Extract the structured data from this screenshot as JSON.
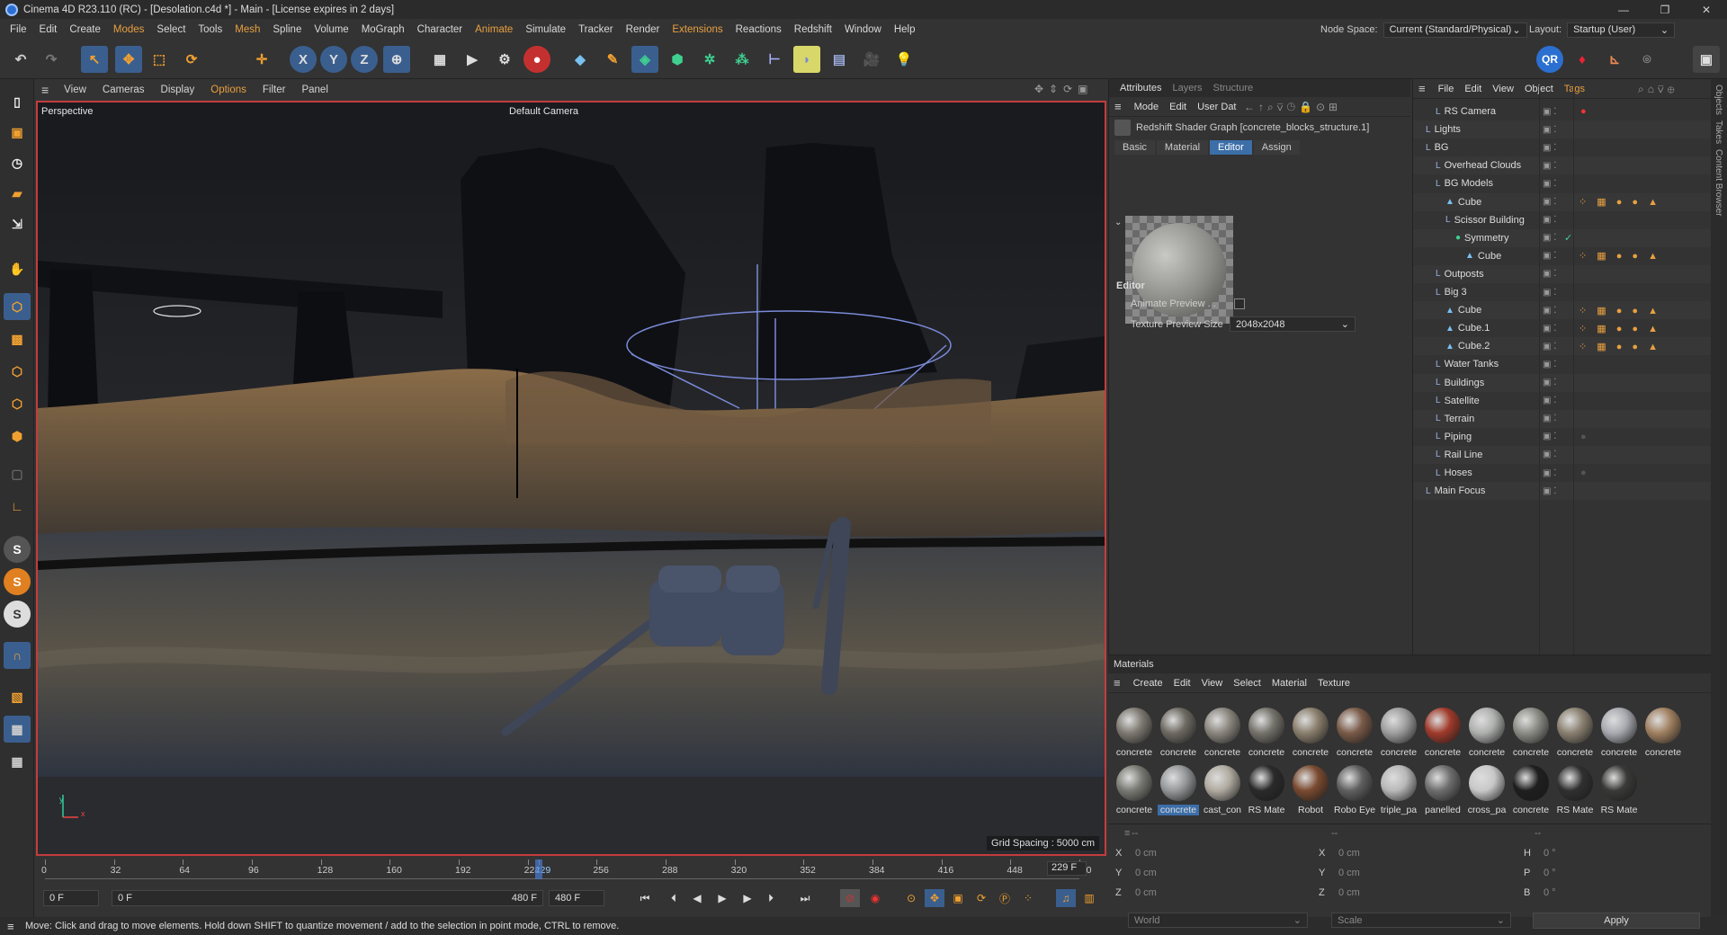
{
  "window": {
    "title": "Cinema 4D R23.110 (RC) - [Desolation.c4d *] - Main - [License expires in 2 days]"
  },
  "menu": [
    "File",
    "Edit",
    "Create",
    "Modes",
    "Select",
    "Tools",
    "Mesh",
    "Spline",
    "Volume",
    "MoGraph",
    "Character",
    "Animate",
    "Simulate",
    "Tracker",
    "Render",
    "Extensions",
    "Reactions",
    "Redshift",
    "Window",
    "Help"
  ],
  "node_space": {
    "label": "Node Space:",
    "value": "Current (Standard/Physical)"
  },
  "layout": {
    "label": "Layout:",
    "value": "Startup (User)"
  },
  "viewport_menu": [
    "View",
    "Cameras",
    "Display",
    "Options",
    "Filter",
    "Panel"
  ],
  "viewport": {
    "name": "Perspective",
    "camera": "Default Camera",
    "grid_spacing": "Grid Spacing : 5000 cm"
  },
  "timeline": {
    "ticks": [
      "0",
      "32",
      "64",
      "96",
      "128",
      "160",
      "192",
      "224",
      "229",
      "256",
      "288",
      "320",
      "352",
      "384",
      "416",
      "448",
      "480"
    ],
    "current_frame": "229 F",
    "start": "0 F",
    "range_start": "0 F",
    "range_end": "480 F",
    "end": "480 F"
  },
  "status": "Move: Click and drag to move elements. Hold down SHIFT to quantize movement / add to the selection in point mode, CTRL to remove.",
  "attributes": {
    "tabs": [
      "Attributes",
      "Layers",
      "Structure"
    ],
    "menu": [
      "Mode",
      "Edit",
      "User Dat"
    ],
    "object_name": "Redshift Shader Graph [concrete_blocks_structure.1]",
    "subtabs": [
      "Basic",
      "Material",
      "Editor",
      "Assign"
    ],
    "section": "Editor",
    "animate_preview": "Animate Preview . .",
    "texture_preview_label": "Texture Preview Size",
    "texture_preview_value": "2048x2048"
  },
  "objects": {
    "menu": [
      "File",
      "Edit",
      "View",
      "Object",
      "Tags"
    ],
    "rows": [
      "RS Camera",
      "Lights",
      "BG",
      "Overhead Clouds",
      "BG Models",
      "Cube",
      "Scissor Building",
      "Symmetry",
      "Cube",
      "Outposts",
      "Big 3",
      "Cube",
      "Cube.1",
      "Cube.2",
      "Water Tanks",
      "Buildings",
      "Satellite",
      "Terrain",
      "Piping",
      "Rail Line",
      "Hoses",
      "Main Focus"
    ]
  },
  "right_rail": [
    "Objects",
    "Takes",
    "Content Browser"
  ],
  "materials": {
    "title": "Materials",
    "menu": [
      "Create",
      "Edit",
      "View",
      "Select",
      "Material",
      "Texture"
    ],
    "row1": [
      "concrete",
      "concrete",
      "concrete",
      "concrete",
      "concrete",
      "concrete",
      "concrete",
      "concrete",
      "concrete",
      "concrete",
      "concrete",
      "concrete",
      "concrete"
    ],
    "row2": [
      "concrete",
      "concrete",
      "cast_con",
      "RS Mate",
      "Robot",
      "Robo Eye",
      "triple_pa",
      "panelled",
      "cross_pa",
      "concrete",
      "RS Mate",
      "RS Mate"
    ],
    "row1_colors": [
      "#7e7a72",
      "#6e6a62",
      "#8a867e",
      "#75726b",
      "#8a7e6c",
      "#7a5a48",
      "#9e9e9e",
      "#a03a2a",
      "#aeb0ae",
      "#8c8c86",
      "#8a8070",
      "#a8aab0",
      "#a08060"
    ],
    "row2_colors": [
      "#7a7a74",
      "#96989a",
      "#b0aaa0",
      "#2a2a2a",
      "#7a4a30",
      "#606060",
      "#b8b8b8",
      "#6e6e6e",
      "#c8c8c8",
      "#1e1e1e",
      "#303030",
      "#3a3a38"
    ]
  },
  "coords": {
    "x": "0 cm",
    "y": "0 cm",
    "z": "0 cm",
    "sx": "0 cm",
    "sy": "0 cm",
    "sz": "0 cm",
    "h": "0 °",
    "p": "0 °",
    "b": "0 °",
    "mode1": "World",
    "mode2": "Scale",
    "apply": "Apply"
  }
}
